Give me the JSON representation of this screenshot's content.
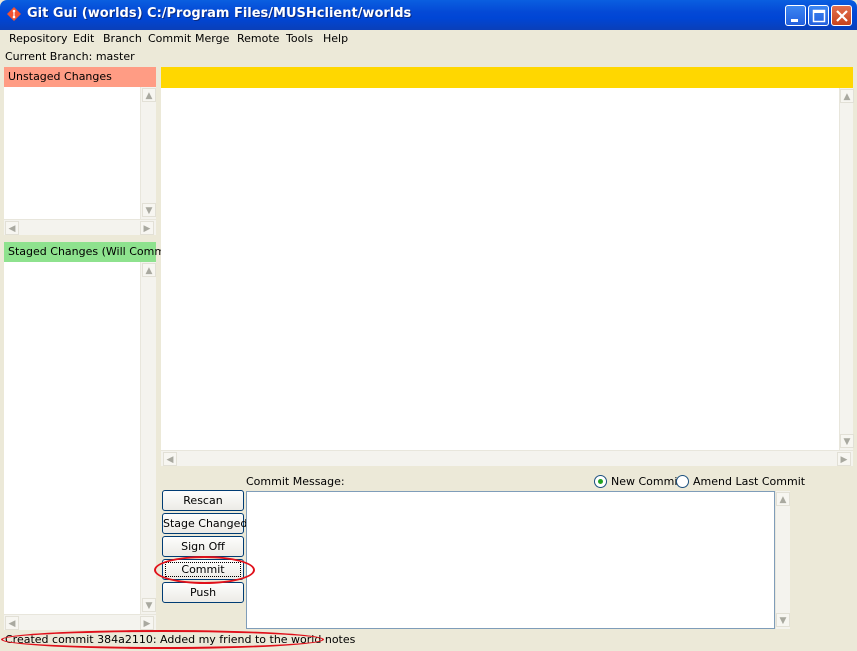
{
  "window": {
    "title": "Git Gui (worlds) C:/Program Files/MUSHclient/worlds",
    "controls": [
      "minimize-icon",
      "maximize-icon",
      "close-icon"
    ]
  },
  "menu": {
    "items": [
      "Repository",
      "Edit",
      "Branch",
      "Commit",
      "Merge",
      "Remote",
      "Tools",
      "Help"
    ]
  },
  "branch": {
    "label": "Current Branch: master"
  },
  "unstaged": {
    "title": "Unstaged Changes",
    "color": "#ff9c84"
  },
  "staged": {
    "title": "Staged Changes (Will Commit)",
    "color": "#8ee28e"
  },
  "diff": {
    "header_color": "#ffd700"
  },
  "commit": {
    "message_label": "Commit Message:",
    "radio_new": "New Commit",
    "radio_amend": "Amend Last Commit",
    "selected": "New Commit",
    "buttons": {
      "rescan": "Rescan",
      "stage_changed": "Stage Changed",
      "sign_off": "Sign Off",
      "commit": "Commit",
      "push": "Push"
    }
  },
  "status": {
    "text": "Created commit 384a2110: Added my friend to the world notes"
  },
  "annotation_color": "#e0101a"
}
